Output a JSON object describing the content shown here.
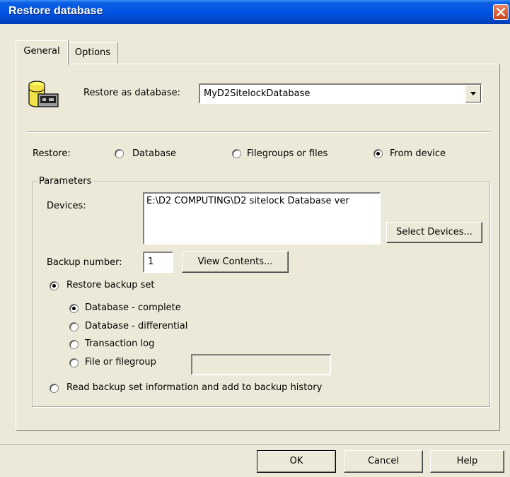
{
  "window": {
    "title": "Restore database"
  },
  "tabs": [
    {
      "label": "General"
    },
    {
      "label": "Options"
    }
  ],
  "general": {
    "restore_as_label": "Restore as database:",
    "restore_as_value": "MyD2SitelockDatabase",
    "restore_label": "Restore:",
    "restore_options": [
      {
        "label": "Database",
        "selected": false
      },
      {
        "label": "Filegroups or files",
        "selected": false
      },
      {
        "label": "From device",
        "selected": true
      }
    ],
    "parameters": {
      "title": "Parameters",
      "devices_label": "Devices:",
      "devices_value": "E:\\D2 COMPUTING\\D2 sitelock Database ver",
      "select_devices_label": "Select Devices...",
      "backup_number_label": "Backup number:",
      "backup_number_value": "1",
      "view_contents_label": "View Contents...",
      "restore_backup_set_label": "Restore backup set",
      "backup_types": [
        {
          "label": "Database - complete",
          "selected": true
        },
        {
          "label": "Database - differential",
          "selected": false
        },
        {
          "label": "Transaction log",
          "selected": false
        },
        {
          "label": "File or filegroup",
          "selected": false
        }
      ],
      "read_info_label": "Read backup set information and add to backup history"
    }
  },
  "buttons": {
    "ok": "OK",
    "cancel": "Cancel",
    "help": "Help"
  },
  "colors": {
    "titlebar": "#0054e3",
    "dialog_bg": "#ece9d8",
    "close_button": "#c9461c"
  }
}
